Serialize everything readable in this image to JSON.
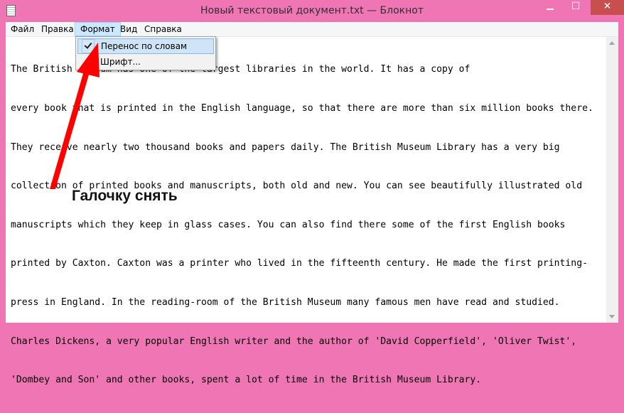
{
  "window": {
    "title": "Новый текстовый документ.txt — Блокнот",
    "close_label": "✕",
    "max_label": "☐"
  },
  "menu": {
    "items": [
      "Файл",
      "Правка",
      "Формат",
      "Вид",
      "Справка"
    ],
    "active": "Формат"
  },
  "format_menu": {
    "items": [
      {
        "label": "Перенос по словам",
        "checked": true,
        "highlighted": true
      },
      {
        "label": "Шрифт...",
        "checked": false,
        "highlighted": false
      }
    ]
  },
  "document": {
    "lines": [
      "The British Museum has one of the largest libraries in the world. It has a copy of",
      "every book that is printed in the English language, so that there are more than six million books there.",
      "They receive nearly two thousand books and papers daily. The British Museum Library has a very big",
      "collection of printed books and manuscripts, both old and new. You can see beautifully illustrated old",
      "manuscripts which they keep in glass cases. You can also find there some of the first English books",
      "printed by Caxton. Caxton was a printer who lived in the fifteenth century. He made the first printing-",
      "press in England. In the reading-room of the British Museum many famous men have read and studied.",
      "Charles Dickens, a very popular English writer and the author of 'David Copperfield', 'Oliver Twist',",
      "'Dombey and Son' and other books, spent a lot of time in the British Museum Library."
    ]
  },
  "annotation": {
    "text": "Галочку снять",
    "arrow_color": "#ff0000"
  },
  "colors": {
    "frame": "#f075b5",
    "menu_highlight": "#cfe4f7",
    "close_button": "#c7504e"
  }
}
